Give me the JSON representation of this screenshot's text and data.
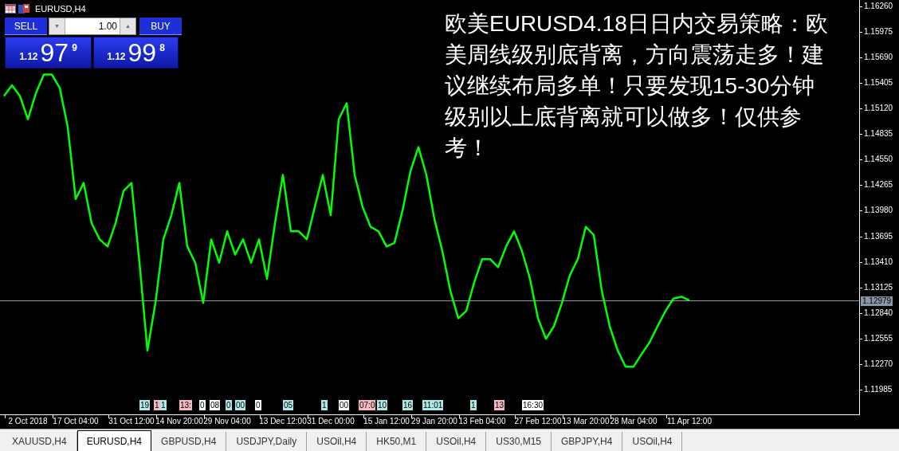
{
  "chart_window": {
    "title": "EURUSD,H4"
  },
  "trade_panel": {
    "sell_label": "SELL",
    "buy_label": "BUY",
    "lot": "1.00",
    "down_arrow": "▼",
    "up_arrow": "▲",
    "bid": {
      "big_figure": "1.12",
      "pips": "97",
      "point": "9"
    },
    "ask": {
      "big_figure": "1.12",
      "pips": "99",
      "point": "8"
    }
  },
  "overlay_note": "欧美EURUSD4.18日日内交易策略：欧美周线级别底背离，方向震荡走多！建议继续布局多单！只要发现15-30分钟级别以上底背离就可以做多！仅供参考！",
  "chart": {
    "chart_data": {
      "type": "line",
      "ylim": [
        1.11708,
        1.16331
      ],
      "categories": [
        null,
        null,
        null,
        "2 Oct 2018",
        null,
        null,
        null,
        null,
        null,
        "17 Oct 04:00",
        null,
        null,
        null,
        null,
        null,
        null,
        "31 Oct 12:00",
        null,
        null,
        null,
        null,
        null,
        "14 Nov 20:00",
        null,
        null,
        null,
        null,
        null,
        "29 Nov 04:00",
        null,
        null,
        null,
        null,
        null,
        null,
        "13 Dec 12:00",
        null,
        null,
        null,
        null,
        null,
        "31 Dec 00:00",
        null,
        null,
        null,
        null,
        null,
        null,
        "15 Jan 12:00",
        null,
        null,
        null,
        null,
        null,
        "29 Jan 20:00",
        null,
        null,
        null,
        null,
        null,
        "13 Feb 04:00",
        null,
        null,
        null,
        null,
        null,
        null,
        "27 Feb 12:00",
        null,
        null,
        null,
        null,
        null,
        "13 Mar 20:00",
        null,
        null,
        null,
        null,
        null,
        "28 Mar 04:00",
        null,
        null,
        null,
        null,
        null,
        null,
        "11 Apr 12:00"
      ],
      "series": [
        {
          "color": "#00ff00",
          "values": [
            1.1526,
            1.1538,
            1.1526,
            1.15,
            1.1529,
            1.155,
            1.155,
            1.1535,
            1.1491,
            1.1411,
            1.1429,
            1.1384,
            1.1366,
            1.1358,
            1.1384,
            1.142,
            1.1429,
            1.134,
            1.1242,
            1.1295,
            1.1366,
            1.1393,
            1.1429,
            1.1358,
            1.134,
            1.1295,
            1.1366,
            1.134,
            1.1375,
            1.1349,
            1.1366,
            1.134,
            1.1366,
            1.1322,
            1.1384,
            1.1438,
            1.1375,
            1.1375,
            1.1366,
            1.1402,
            1.1438,
            1.1393,
            1.15,
            1.1518,
            1.1438,
            1.1402,
            1.138,
            1.1375,
            1.1358,
            1.1362,
            1.1398,
            1.1442,
            1.1469,
            1.1438,
            1.1389,
            1.1353,
            1.1309,
            1.1278,
            1.1286,
            1.1318,
            1.1344,
            1.1344,
            1.1335,
            1.1358,
            1.1375,
            1.1353,
            1.1322,
            1.1278,
            1.1255,
            1.1269,
            1.1295,
            1.1326,
            1.1344,
            1.138,
            1.1371,
            1.1309,
            1.1269,
            1.1242,
            1.1224,
            1.1224,
            1.1238,
            1.1251,
            1.1269,
            1.1286,
            1.13,
            1.1302,
            1.1298
          ]
        }
      ],
      "ref_lines": [
        {
          "axis": "y",
          "value": 1.12979,
          "label": "1.12979",
          "color": "#8a97a8"
        }
      ],
      "yticks": [
        {
          "value": 1.1626,
          "label": "1.16260"
        },
        {
          "value": 1.15975,
          "label": "1.15975"
        },
        {
          "value": 1.1569,
          "label": "1.15690"
        },
        {
          "value": 1.15405,
          "label": "1.15405"
        },
        {
          "value": 1.1512,
          "label": "1.15120"
        },
        {
          "value": 1.14835,
          "label": "1.14835"
        },
        {
          "value": 1.1455,
          "label": "1.14550"
        },
        {
          "value": 1.14265,
          "label": "1.14265"
        },
        {
          "value": 1.1398,
          "label": "1.13980"
        },
        {
          "value": 1.13695,
          "label": "1.13695"
        },
        {
          "value": 1.1341,
          "label": "1.13410"
        },
        {
          "value": 1.13125,
          "label": "1.13125"
        },
        {
          "value": 1.1284,
          "label": "1.12840"
        },
        {
          "value": 1.12555,
          "label": "1.12555"
        },
        {
          "value": 1.1227,
          "label": "1.12270"
        },
        {
          "value": 1.11985,
          "label": "1.11985"
        }
      ],
      "stacked": false
    }
  },
  "event_markers": [
    {
      "label": "19",
      "color": "#aee8e8"
    },
    {
      "label": "1",
      "color": "#f4b8c0"
    },
    {
      "label": "1",
      "color": "#aee8e8"
    },
    {
      "label": "13:",
      "color": "#f4b8c0"
    },
    {
      "label": "0",
      "color": "#ffffff"
    },
    {
      "label": "08",
      "color": "#ffffff"
    },
    {
      "label": "0",
      "color": "#aee8e8"
    },
    {
      "label": "00",
      "color": "#aee8e8"
    },
    {
      "label": "0",
      "color": "#ffffff"
    },
    {
      "label": "05",
      "color": "#aee8e8"
    },
    {
      "label": "1",
      "color": "#aee8e8"
    },
    {
      "label": "00",
      "color": "#ffffff"
    },
    {
      "label": "07:0",
      "color": "#f4b8c0"
    },
    {
      "label": "10",
      "color": "#aee8e8"
    },
    {
      "label": "16",
      "color": "#aee8e8"
    },
    {
      "label": "11:01",
      "color": "#aee8e8"
    },
    {
      "label": "1",
      "color": "#aee8e8"
    },
    {
      "label": "13",
      "color": "#f4b8c0"
    },
    {
      "label": "16:30",
      "color": "#ffffff"
    }
  ],
  "tabs": [
    {
      "label": "XAUUSD,H4",
      "selected": false
    },
    {
      "label": "EURUSD,H4",
      "selected": true
    },
    {
      "label": "GBPUSD,H4",
      "selected": false
    },
    {
      "label": "USDJPY,Daily",
      "selected": false
    },
    {
      "label": "USOil,H4",
      "selected": false
    },
    {
      "label": "HK50,M1",
      "selected": false
    },
    {
      "label": "USOil,H4",
      "selected": false
    },
    {
      "label": "US30,M15",
      "selected": false
    },
    {
      "label": "GBPJPY,H4",
      "selected": false
    },
    {
      "label": "USOil,H4",
      "selected": false
    }
  ]
}
